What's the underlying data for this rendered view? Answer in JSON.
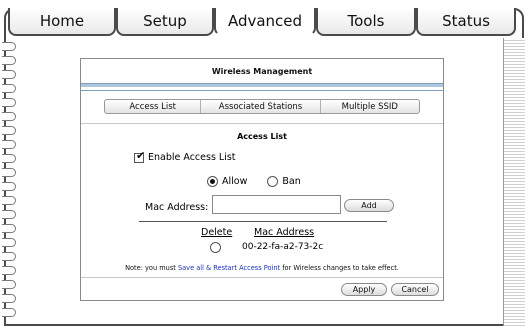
{
  "tabs": [
    {
      "label": "Home"
    },
    {
      "label": "Setup"
    },
    {
      "label": "Advanced"
    },
    {
      "label": "Tools"
    },
    {
      "label": "Status"
    }
  ],
  "panel": {
    "title": "Wireless Management",
    "subtabs": [
      "Access List",
      "Associated Stations",
      "Multiple SSID"
    ],
    "section_title": "Access List",
    "enable_label": "Enable Access List",
    "enable_checked": true,
    "mode_options": [
      {
        "label": "Allow",
        "selected": true
      },
      {
        "label": "Ban",
        "selected": false
      }
    ],
    "mac_label": "Mac Address:",
    "mac_value": "",
    "add_label": "Add",
    "col_delete": "Delete",
    "col_mac": "Mac Address",
    "entries": [
      {
        "mac": "00-22-fa-a2-73-2c"
      }
    ],
    "note_prefix": "Note: you must ",
    "note_link": "Save all & Restart Access Point",
    "note_suffix": " for Wireless changes to take effect.",
    "apply_label": "Apply",
    "cancel_label": "Cancel"
  },
  "colors": {
    "link": "#1a33cc",
    "panel_rule": "#aec6dc"
  }
}
